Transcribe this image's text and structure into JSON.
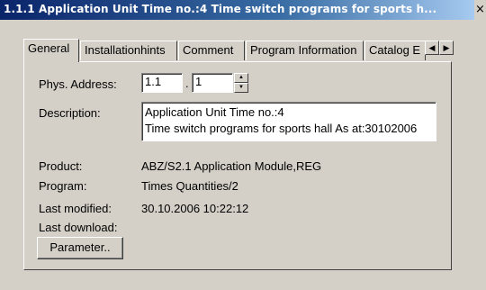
{
  "window": {
    "title": "1.1.1 Application Unit Time no.:4  Time switch programs for sports h...",
    "close_icon": "close-icon"
  },
  "tabs": [
    {
      "label": "General",
      "active": true
    },
    {
      "label": "Installationhints",
      "active": false
    },
    {
      "label": "Comment",
      "active": false
    },
    {
      "label": "Program Information",
      "active": false
    },
    {
      "label": "Catalog E",
      "active": false
    }
  ],
  "tab_scroll": {
    "left": "◀",
    "right": "▶"
  },
  "general": {
    "phys_address_label": "Phys. Address:",
    "phys_address_part1": "1.1",
    "phys_address_separator": ".",
    "phys_address_part2": "1",
    "description_label": "Description:",
    "description_line1": "Application Unit Time no.:4",
    "description_line2": "Time switch programs for sports hall As at:30102006",
    "product_label": "Product:",
    "product_value": "ABZ/S2.1 Application Module,REG",
    "program_label": "Program:",
    "program_value": "Times Quantities/2",
    "last_modified_label": "Last modified:",
    "last_modified_value": "30.10.2006 10:22:12",
    "last_download_label": "Last download:",
    "last_download_value": "",
    "parameter_button": "Parameter.."
  }
}
